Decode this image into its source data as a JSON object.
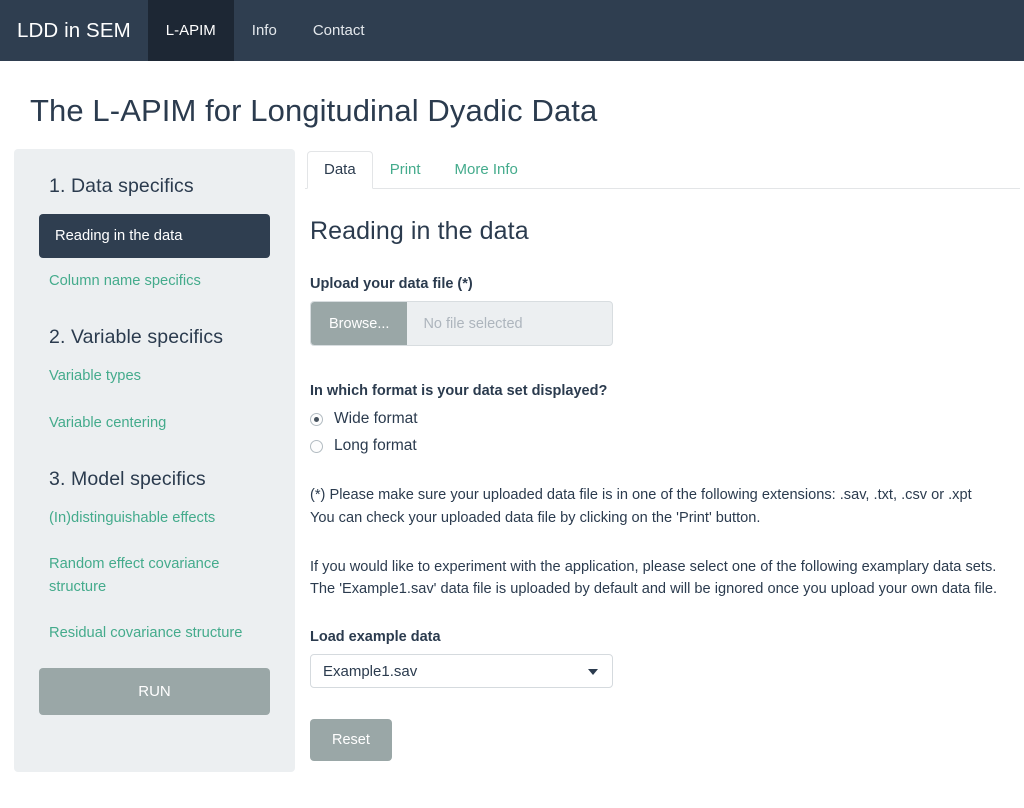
{
  "navbar": {
    "brand": "LDD in SEM",
    "items": [
      {
        "label": "L-APIM",
        "active": true
      },
      {
        "label": "Info",
        "active": false
      },
      {
        "label": "Contact",
        "active": false
      }
    ]
  },
  "page": {
    "title": "The L-APIM for Longitudinal Dyadic Data"
  },
  "sidebar": {
    "section1_heading": "1. Data specifics",
    "item_reading": "Reading in the data",
    "item_column": "Column name specifics",
    "section2_heading": "2. Variable specifics",
    "item_var_types": "Variable types",
    "item_var_centering": "Variable centering",
    "section3_heading": "3. Model specifics",
    "item_indist": "(In)distinguishable effects",
    "item_random": "Random effect covariance structure",
    "item_residual": "Residual covariance structure",
    "run_label": "RUN"
  },
  "tabs": [
    {
      "label": "Data",
      "active": true
    },
    {
      "label": "Print",
      "active": false
    },
    {
      "label": "More Info",
      "active": false
    }
  ],
  "main": {
    "section_title": "Reading in the data",
    "upload_label": "Upload your data file (*)",
    "browse_label": "Browse...",
    "file_placeholder": "No file selected",
    "format_question": "In which format is your data set displayed?",
    "radio_wide": "Wide format",
    "radio_long": "Long format",
    "note_line1": "(*) Please make sure your uploaded data file is in one of the following extensions: .sav, .txt, .csv or .xpt",
    "note_line2": "You can check your uploaded data file by clicking on the 'Print' button.",
    "example_line1": "If you would like to experiment with the application, please select one of the following examplary data sets.",
    "example_line2": "The 'Example1.sav' data file is uploaded by default and will be ignored once you upload your own data file.",
    "select_label": "Load example data",
    "select_value": "Example1.sav",
    "reset_label": "Reset"
  },
  "colors": {
    "navbar_bg": "#2f3e50",
    "navbar_active_bg": "#1d2734",
    "accent_green": "#44ab8c",
    "sidebar_bg": "#eceff1",
    "button_gray": "#9aa7a7",
    "text_dark": "#2b3b4e"
  }
}
